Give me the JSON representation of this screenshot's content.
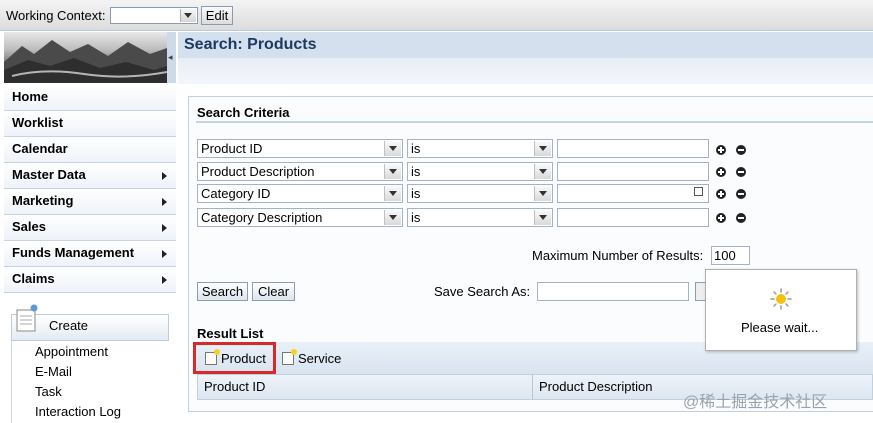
{
  "topbar": {
    "working_context_label": "Working Context:",
    "working_context_value": "",
    "edit_label": "Edit"
  },
  "nav": {
    "items": [
      {
        "label": "Home",
        "has_submenu": false
      },
      {
        "label": "Worklist",
        "has_submenu": false
      },
      {
        "label": "Calendar",
        "has_submenu": false
      },
      {
        "label": "Master Data",
        "has_submenu": true
      },
      {
        "label": "Marketing",
        "has_submenu": true
      },
      {
        "label": "Sales",
        "has_submenu": true
      },
      {
        "label": "Funds Management",
        "has_submenu": true
      },
      {
        "label": "Claims",
        "has_submenu": true
      }
    ],
    "create": {
      "label": "Create",
      "items": [
        "Appointment",
        "E-Mail",
        "Task",
        "Interaction Log"
      ]
    }
  },
  "page": {
    "title": "Search: Products"
  },
  "criteria": {
    "title": "Search Criteria",
    "rows": [
      {
        "field": "Product ID",
        "operator": "is",
        "value": "",
        "value_help": false
      },
      {
        "field": "Product Description",
        "operator": "is",
        "value": "",
        "value_help": false
      },
      {
        "field": "Category ID",
        "operator": "is",
        "value": "",
        "value_help": true
      },
      {
        "field": "Category Description",
        "operator": "is",
        "value": "",
        "value_help": false
      }
    ],
    "max_results_label": "Maximum Number of Results:",
    "max_results_value": "100",
    "search_label": "Search",
    "clear_label": "Clear",
    "save_search_label": "Save Search As:",
    "save_search_value": ""
  },
  "results": {
    "title": "Result List",
    "toolbar": [
      "Product",
      "Service"
    ],
    "columns": [
      "Product ID",
      "Product Description"
    ]
  },
  "popup": {
    "text": "Please wait..."
  },
  "watermark": "@稀土掘金技术社区",
  "colors": {
    "highlight": "#d92a2a",
    "title_text": "#1d3a60",
    "header_bg": "#d5e0ee"
  }
}
